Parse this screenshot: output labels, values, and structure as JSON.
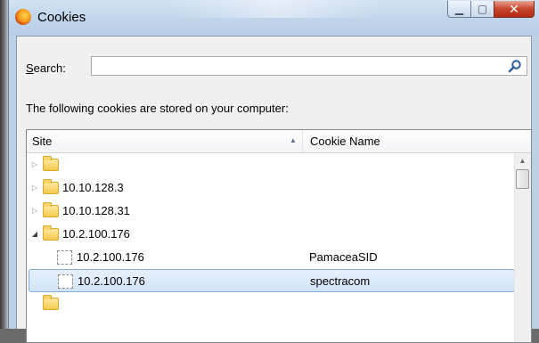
{
  "window": {
    "title": "Cookies",
    "minimize_glyph": "▁",
    "maximize_glyph": "▢",
    "close_glyph": "✕"
  },
  "search": {
    "label_accesskey": "S",
    "label_rest": "earch:",
    "value": "",
    "placeholder": ""
  },
  "info_text": "The following cookies are stored on your computer:",
  "tree": {
    "columns": [
      "Site",
      "Cookie Name"
    ],
    "sort_indicator": "▲",
    "rows": [
      {
        "type": "folder",
        "expander": "▷",
        "site": "",
        "cookie": ""
      },
      {
        "type": "folder",
        "expander": "▷",
        "site": "10.10.128.3",
        "cookie": ""
      },
      {
        "type": "folder",
        "expander": "▷",
        "site": "10.10.128.31",
        "cookie": ""
      },
      {
        "type": "folder",
        "expander": "◢",
        "site": "10.2.100.176",
        "cookie": ""
      },
      {
        "type": "cookie",
        "expander": "",
        "site": "10.2.100.176",
        "cookie": "PamaceaSID"
      },
      {
        "type": "cookie",
        "expander": "",
        "site": "10.2.100.176",
        "cookie": "spectracom",
        "selected": true
      }
    ]
  },
  "scrollbar": {
    "up_glyph": "▲"
  },
  "colors": {
    "title_bar": "#c2d6ec",
    "close_button": "#c7452c",
    "selection": "#d2e4f8",
    "folder": "#f4c94e"
  }
}
